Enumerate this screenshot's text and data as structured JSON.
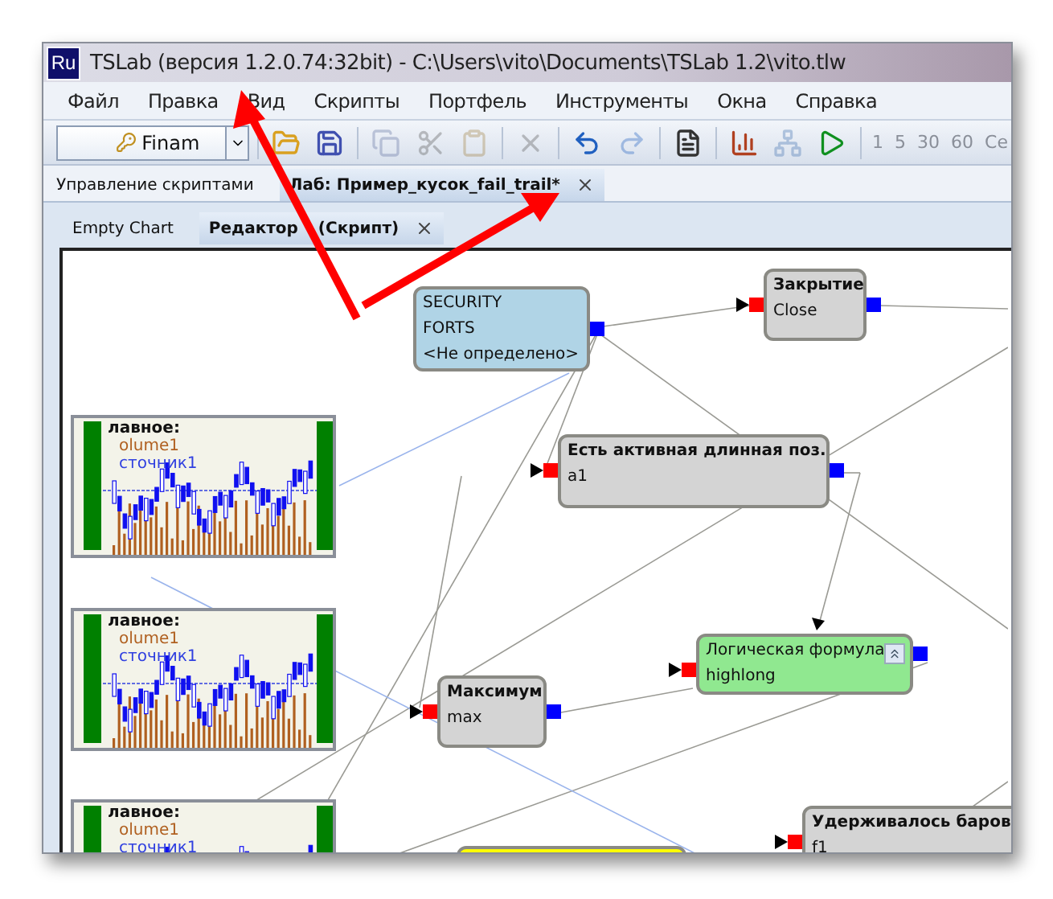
{
  "window": {
    "app_icon": "Ru",
    "title": "TSLab (версия 1.2.0.74:32bit) - C:\\Users\\vito\\Documents\\TSLab 1.2\\vito.tlw"
  },
  "menu": [
    "Файл",
    "Правка",
    "Вид",
    "Скрипты",
    "Портфель",
    "Инструменты",
    "Окна",
    "Справка"
  ],
  "toolbar": {
    "connection": "Finam",
    "buttons": [
      {
        "disabled": false
      },
      {
        "disabled": false
      },
      {
        "disabled": true
      },
      {
        "disabled": true
      },
      {
        "disabled": true
      },
      {
        "disabled": true
      },
      {
        "disabled": false
      },
      {
        "disabled": true
      },
      {
        "disabled": false
      },
      {
        "disabled": false
      },
      {
        "disabled": true
      },
      {
        "disabled": false
      }
    ],
    "periods": [
      {
        "label": "1",
        "disabled": true
      },
      {
        "label": "5",
        "disabled": true
      },
      {
        "label": "30",
        "disabled": true
      },
      {
        "label": "60",
        "disabled": true
      },
      {
        "label": "Ce",
        "disabled": true
      }
    ]
  },
  "document_tabs": [
    {
      "label": "Управление скриптами",
      "selected": false,
      "closable": false
    },
    {
      "label": "Лаб: Пример_кусок_fail_trail*",
      "selected": true,
      "closable": true
    }
  ],
  "editor_tabs": [
    {
      "label": "Empty Chart",
      "selected": false,
      "closable": false
    },
    {
      "label": "Редактор (Скрипт)",
      "selected": true,
      "closable": true
    }
  ],
  "canvas": {
    "nodes": [
      {
        "kind": "source",
        "color": "#b0d4e6",
        "lines": [
          "SECURITY",
          "FORTS",
          "<Не определено>"
        ]
      },
      {
        "kind": "block",
        "color": "#d4d4d4",
        "title": "Закрытие",
        "name": "Close"
      },
      {
        "kind": "block",
        "color": "#d4d4d4",
        "title": "Есть активная длинная поз.",
        "name": "a1"
      },
      {
        "kind": "formula",
        "color": "#90e890",
        "title": "Логическая формула",
        "name": "highlong"
      },
      {
        "kind": "block",
        "color": "#d4d4d4",
        "title": "Максимум",
        "name": "max"
      },
      {
        "kind": "block",
        "color": "#d4d4d4",
        "title": "Удерживалось баров",
        "name": "f1"
      },
      {
        "kind": "block",
        "color": "#ffff00"
      }
    ],
    "charts": [
      {
        "lines": [
          "лавное:",
          "olume1",
          "сточник1"
        ]
      },
      {
        "lines": [
          "лавное:",
          "olume1",
          "сточник1"
        ]
      },
      {
        "lines": [
          "лавное:",
          "olume1",
          "сточник1"
        ]
      }
    ]
  }
}
